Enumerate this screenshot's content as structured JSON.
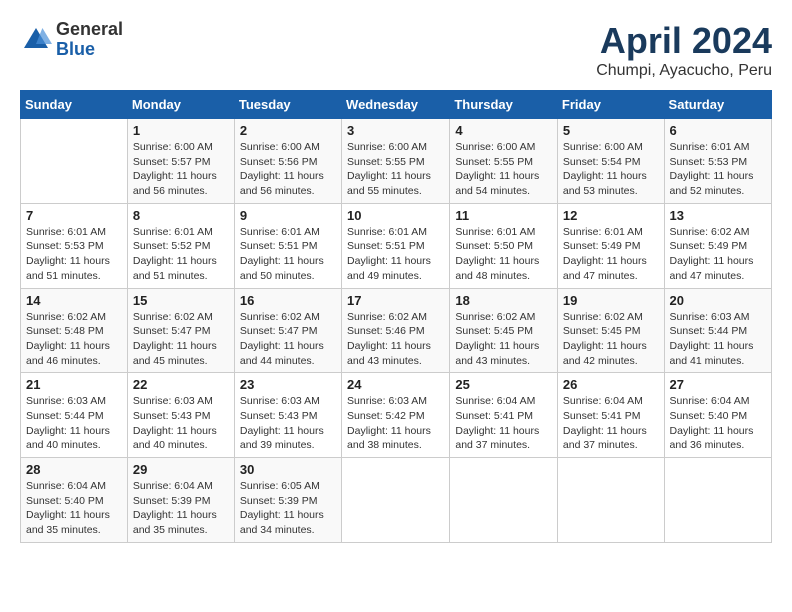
{
  "header": {
    "logo": {
      "general": "General",
      "blue": "Blue"
    },
    "title": "April 2024",
    "location": "Chumpi, Ayacucho, Peru"
  },
  "calendar": {
    "days_of_week": [
      "Sunday",
      "Monday",
      "Tuesday",
      "Wednesday",
      "Thursday",
      "Friday",
      "Saturday"
    ],
    "weeks": [
      [
        {
          "day": "",
          "detail": ""
        },
        {
          "day": "1",
          "detail": "Sunrise: 6:00 AM\nSunset: 5:57 PM\nDaylight: 11 hours\nand 56 minutes."
        },
        {
          "day": "2",
          "detail": "Sunrise: 6:00 AM\nSunset: 5:56 PM\nDaylight: 11 hours\nand 56 minutes."
        },
        {
          "day": "3",
          "detail": "Sunrise: 6:00 AM\nSunset: 5:55 PM\nDaylight: 11 hours\nand 55 minutes."
        },
        {
          "day": "4",
          "detail": "Sunrise: 6:00 AM\nSunset: 5:55 PM\nDaylight: 11 hours\nand 54 minutes."
        },
        {
          "day": "5",
          "detail": "Sunrise: 6:00 AM\nSunset: 5:54 PM\nDaylight: 11 hours\nand 53 minutes."
        },
        {
          "day": "6",
          "detail": "Sunrise: 6:01 AM\nSunset: 5:53 PM\nDaylight: 11 hours\nand 52 minutes."
        }
      ],
      [
        {
          "day": "7",
          "detail": "Sunrise: 6:01 AM\nSunset: 5:53 PM\nDaylight: 11 hours\nand 51 minutes."
        },
        {
          "day": "8",
          "detail": "Sunrise: 6:01 AM\nSunset: 5:52 PM\nDaylight: 11 hours\nand 51 minutes."
        },
        {
          "day": "9",
          "detail": "Sunrise: 6:01 AM\nSunset: 5:51 PM\nDaylight: 11 hours\nand 50 minutes."
        },
        {
          "day": "10",
          "detail": "Sunrise: 6:01 AM\nSunset: 5:51 PM\nDaylight: 11 hours\nand 49 minutes."
        },
        {
          "day": "11",
          "detail": "Sunrise: 6:01 AM\nSunset: 5:50 PM\nDaylight: 11 hours\nand 48 minutes."
        },
        {
          "day": "12",
          "detail": "Sunrise: 6:01 AM\nSunset: 5:49 PM\nDaylight: 11 hours\nand 47 minutes."
        },
        {
          "day": "13",
          "detail": "Sunrise: 6:02 AM\nSunset: 5:49 PM\nDaylight: 11 hours\nand 47 minutes."
        }
      ],
      [
        {
          "day": "14",
          "detail": "Sunrise: 6:02 AM\nSunset: 5:48 PM\nDaylight: 11 hours\nand 46 minutes."
        },
        {
          "day": "15",
          "detail": "Sunrise: 6:02 AM\nSunset: 5:47 PM\nDaylight: 11 hours\nand 45 minutes."
        },
        {
          "day": "16",
          "detail": "Sunrise: 6:02 AM\nSunset: 5:47 PM\nDaylight: 11 hours\nand 44 minutes."
        },
        {
          "day": "17",
          "detail": "Sunrise: 6:02 AM\nSunset: 5:46 PM\nDaylight: 11 hours\nand 43 minutes."
        },
        {
          "day": "18",
          "detail": "Sunrise: 6:02 AM\nSunset: 5:45 PM\nDaylight: 11 hours\nand 43 minutes."
        },
        {
          "day": "19",
          "detail": "Sunrise: 6:02 AM\nSunset: 5:45 PM\nDaylight: 11 hours\nand 42 minutes."
        },
        {
          "day": "20",
          "detail": "Sunrise: 6:03 AM\nSunset: 5:44 PM\nDaylight: 11 hours\nand 41 minutes."
        }
      ],
      [
        {
          "day": "21",
          "detail": "Sunrise: 6:03 AM\nSunset: 5:44 PM\nDaylight: 11 hours\nand 40 minutes."
        },
        {
          "day": "22",
          "detail": "Sunrise: 6:03 AM\nSunset: 5:43 PM\nDaylight: 11 hours\nand 40 minutes."
        },
        {
          "day": "23",
          "detail": "Sunrise: 6:03 AM\nSunset: 5:43 PM\nDaylight: 11 hours\nand 39 minutes."
        },
        {
          "day": "24",
          "detail": "Sunrise: 6:03 AM\nSunset: 5:42 PM\nDaylight: 11 hours\nand 38 minutes."
        },
        {
          "day": "25",
          "detail": "Sunrise: 6:04 AM\nSunset: 5:41 PM\nDaylight: 11 hours\nand 37 minutes."
        },
        {
          "day": "26",
          "detail": "Sunrise: 6:04 AM\nSunset: 5:41 PM\nDaylight: 11 hours\nand 37 minutes."
        },
        {
          "day": "27",
          "detail": "Sunrise: 6:04 AM\nSunset: 5:40 PM\nDaylight: 11 hours\nand 36 minutes."
        }
      ],
      [
        {
          "day": "28",
          "detail": "Sunrise: 6:04 AM\nSunset: 5:40 PM\nDaylight: 11 hours\nand 35 minutes."
        },
        {
          "day": "29",
          "detail": "Sunrise: 6:04 AM\nSunset: 5:39 PM\nDaylight: 11 hours\nand 35 minutes."
        },
        {
          "day": "30",
          "detail": "Sunrise: 6:05 AM\nSunset: 5:39 PM\nDaylight: 11 hours\nand 34 minutes."
        },
        {
          "day": "",
          "detail": ""
        },
        {
          "day": "",
          "detail": ""
        },
        {
          "day": "",
          "detail": ""
        },
        {
          "day": "",
          "detail": ""
        }
      ]
    ]
  }
}
